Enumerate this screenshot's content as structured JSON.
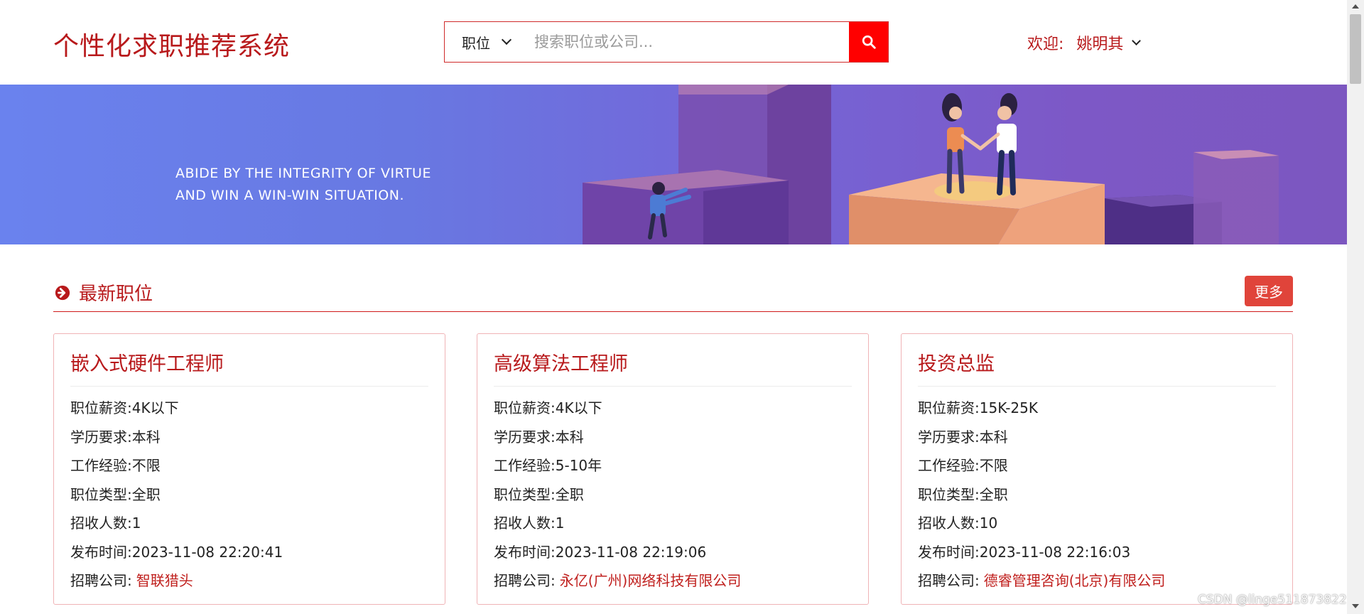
{
  "header": {
    "logo": "个性化求职推荐系统",
    "search": {
      "category": "职位",
      "placeholder": "搜索职位或公司...",
      "button_icon": "search-icon"
    },
    "welcome_label": "欢迎:",
    "username": "姚明其"
  },
  "banner": {
    "line1": "ABIDE BY THE INTEGRITY OF VIRTUE",
    "line2": "AND WIN A WIN-WIN SITUATION."
  },
  "section": {
    "icon": "arrow-circle-right-icon",
    "title": "最新职位",
    "more_label": "更多"
  },
  "jobs": [
    {
      "title": "嵌入式硬件工程师",
      "salary_label": "职位薪资:",
      "salary": "4K以下",
      "education_label": "学历要求:",
      "education": "本科",
      "experience_label": "工作经验:",
      "experience": "不限",
      "type_label": "职位类型:",
      "type": "全职",
      "count_label": "招收人数:",
      "count": "1",
      "time_label": "发布时间:",
      "time": "2023-11-08 22:20:41",
      "company_label": "招聘公司:",
      "company": "智联猎头"
    },
    {
      "title": "高级算法工程师",
      "salary_label": "职位薪资:",
      "salary": "4K以下",
      "education_label": "学历要求:",
      "education": "本科",
      "experience_label": "工作经验:",
      "experience": "5-10年",
      "type_label": "职位类型:",
      "type": "全职",
      "count_label": "招收人数:",
      "count": "1",
      "time_label": "发布时间:",
      "time": "2023-11-08 22:19:06",
      "company_label": "招聘公司:",
      "company": "永亿(广州)网络科技有限公司"
    },
    {
      "title": "投资总监",
      "salary_label": "职位薪资:",
      "salary": "15K-25K",
      "education_label": "学历要求:",
      "education": "本科",
      "experience_label": "工作经验:",
      "experience": "不限",
      "type_label": "职位类型:",
      "type": "全职",
      "count_label": "招收人数:",
      "count": "10",
      "time_label": "发布时间:",
      "time": "2023-11-08 22:16:03",
      "company_label": "招聘公司:",
      "company": "德睿管理咨询(北京)有限公司"
    }
  ],
  "watermark": "CSDN @linge511873822",
  "colors": {
    "brand_red": "#b8191b",
    "search_button": "#ff0000",
    "more_button": "#e0443a",
    "banner_start": "#6a82ee",
    "banner_end": "#7c57c0"
  }
}
